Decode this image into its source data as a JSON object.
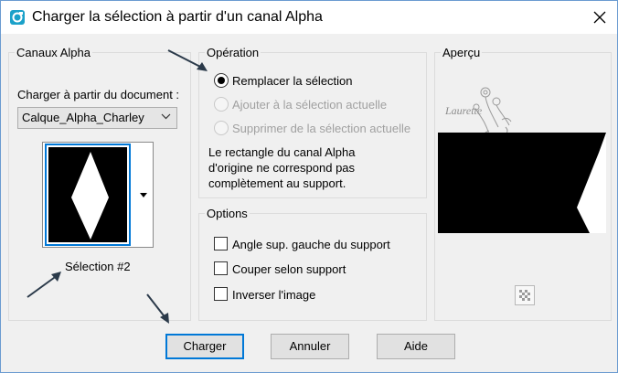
{
  "window": {
    "title": "Charger la sélection à partir d'un canal Alpha"
  },
  "left_panel": {
    "legend": "Canaux Alpha",
    "document_label": "Charger à partir du document :",
    "document_value": "Calque_Alpha_Charley",
    "selection_name": "Sélection #2"
  },
  "operation": {
    "legend": "Opération",
    "options": [
      {
        "label": "Remplacer la sélection",
        "selected": true,
        "enabled": true
      },
      {
        "label": "Ajouter à la sélection actuelle",
        "selected": false,
        "enabled": false
      },
      {
        "label": "Supprimer de la sélection actuelle",
        "selected": false,
        "enabled": false
      }
    ],
    "info": [
      "Le rectangle du canal Alpha",
      "d'origine ne correspond pas",
      "complètement au support."
    ]
  },
  "options": {
    "legend": "Options",
    "checkboxes": [
      {
        "label": "Angle sup. gauche du support",
        "checked": false
      },
      {
        "label": "Couper selon support",
        "checked": false
      },
      {
        "label": "Inverser l'image",
        "checked": false
      }
    ]
  },
  "preview": {
    "legend": "Aperçu",
    "watermark": "Laurette"
  },
  "buttons": {
    "load": "Charger",
    "cancel": "Annuler",
    "help": "Aide"
  },
  "colors": {
    "accent": "#0078d7",
    "arrow": "#2b3a4a"
  }
}
